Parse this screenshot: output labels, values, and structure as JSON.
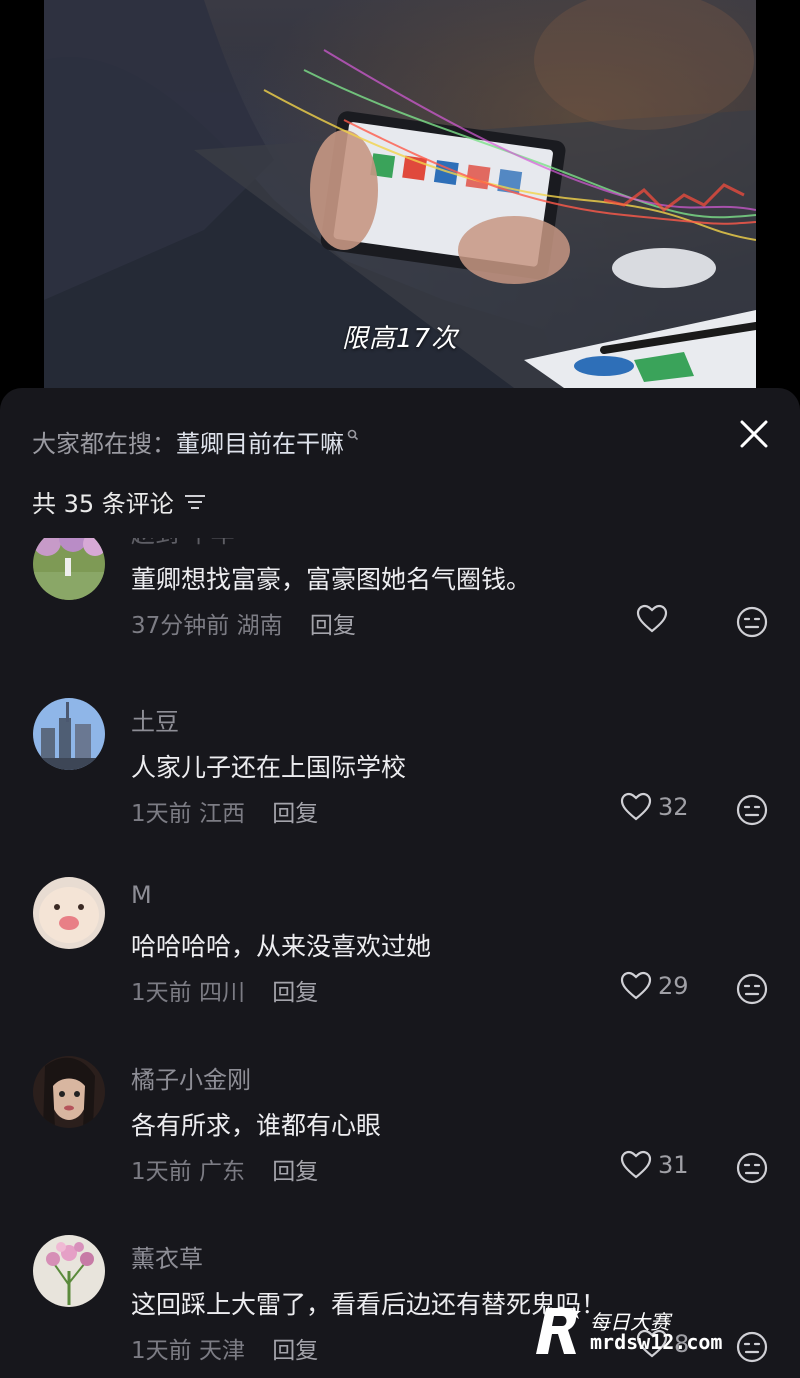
{
  "video": {
    "subtitle": "限高17次"
  },
  "sheet": {
    "search_prefix": "大家都在搜：",
    "search_term": "董卿目前在干嘛",
    "comment_count_label": "共 35 条评论"
  },
  "comments": [
    {
      "username": "赵到 千年",
      "text": "董卿想找富豪，富豪图她名气圈钱。",
      "time": "37分钟前",
      "location": "湖南",
      "reply_label": "回复",
      "likes": ""
    },
    {
      "username": "土豆",
      "text": "人家儿子还在上国际学校",
      "time": "1天前",
      "location": "江西",
      "reply_label": "回复",
      "likes": "32"
    },
    {
      "username": "M",
      "text": "哈哈哈哈，从来没喜欢过她",
      "time": "1天前",
      "location": "四川",
      "reply_label": "回复",
      "likes": "29"
    },
    {
      "username": "橘子小金刚",
      "text": "各有所求，谁都有心眼",
      "time": "1天前",
      "location": "广东",
      "reply_label": "回复",
      "likes": "31"
    },
    {
      "username": "薰衣草",
      "text": "这回踩上大雷了，看看后边还有替死鬼吗！",
      "time": "1天前",
      "location": "天津",
      "reply_label": "回复",
      "likes": "8"
    }
  ],
  "watermark": {
    "name": "每日大赛",
    "url": "mrdsw12.com"
  },
  "icons": {
    "close": "close-icon",
    "sort": "sort-icon",
    "like": "heart-icon",
    "dislike": "meh-face-icon"
  }
}
